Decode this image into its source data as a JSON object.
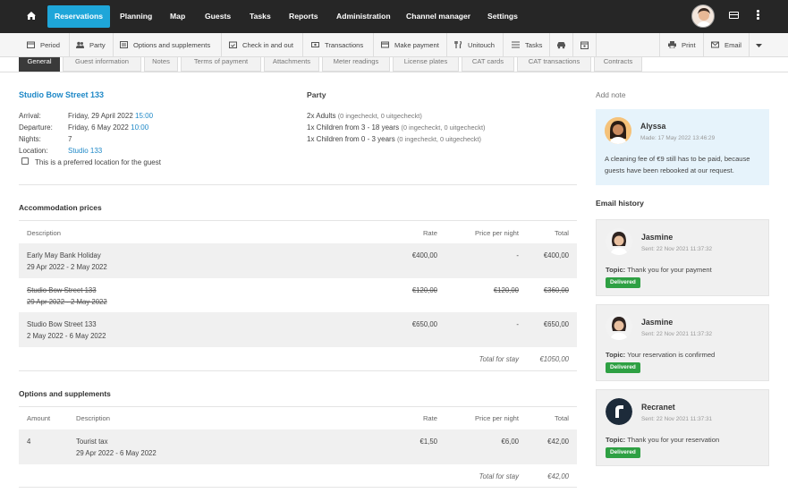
{
  "topnav": {
    "items": [
      "Reservations",
      "Planning",
      "Map",
      "Guests",
      "Tasks",
      "Reports",
      "Administration",
      "Channel manager",
      "Settings"
    ],
    "active": "Reservations",
    "accent_color": "#1ea6d9"
  },
  "subnav": {
    "items": [
      {
        "label": "Period",
        "icon": "calendar-icon"
      },
      {
        "label": "Party",
        "icon": "users-icon"
      },
      {
        "label": "Options and supplements",
        "icon": "options-icon"
      },
      {
        "label": "Check in and out",
        "icon": "calendar-check-icon"
      },
      {
        "label": "Transactions",
        "icon": "money-icon"
      },
      {
        "label": "Make payment",
        "icon": "credit-card-icon"
      },
      {
        "label": "Unitouch",
        "icon": "cutlery-icon"
      },
      {
        "label": "Tasks",
        "icon": "list-icon"
      }
    ],
    "print_label": "Print",
    "email_label": "Email"
  },
  "tabs": [
    "General",
    "Guest information",
    "Notes",
    "Terms of payment",
    "Attachments",
    "Meter readings",
    "License plates",
    "CAT cards",
    "CAT transactions",
    "Contracts"
  ],
  "reservation": {
    "location_title": "Studio Bow Street 133",
    "arrival_label": "Arrival:",
    "arrival_date": "Friday, 29 April 2022",
    "arrival_time": "15:00",
    "departure_label": "Departure:",
    "departure_date": "Friday, 6 May 2022",
    "departure_time": "10:00",
    "nights_label": "Nights:",
    "nights": "7",
    "location_label": "Location:",
    "location": "Studio 133",
    "preferred_label": "This is a preferred location for the guest"
  },
  "party": {
    "title": "Party",
    "lines": [
      {
        "main": "2x Adults",
        "detail": "(0 ingecheckt, 0 uitgecheckt)"
      },
      {
        "main": "1x Children from 3 - 18 years",
        "detail": "(0 ingecheckt, 0 uitgecheckt)"
      },
      {
        "main": "1x Children from 0 - 3 years",
        "detail": "(0 ingecheckt, 0 uitgecheckt)"
      }
    ]
  },
  "accommodation": {
    "title": "Accommodation prices",
    "headers": {
      "description": "Description",
      "rate": "Rate",
      "ppn": "Price per night",
      "total": "Total"
    },
    "rows": [
      {
        "name": "Early May Bank Holiday",
        "dates": "29 Apr 2022 - 2 May 2022",
        "rate": "€400,00",
        "ppn": "-",
        "total": "€400,00",
        "struck": false
      },
      {
        "name": "Studio Bow Street 133",
        "dates": "29 Apr 2022 - 2 May 2022",
        "rate": "€120,00",
        "ppn": "€120,00",
        "total": "€360,00",
        "struck": true
      },
      {
        "name": "Studio Bow Street 133",
        "dates": "2 May 2022 - 6 May 2022",
        "rate": "€650,00",
        "ppn": "-",
        "total": "€650,00",
        "struck": false
      }
    ],
    "total_label": "Total for stay",
    "total": "€1050,00"
  },
  "options": {
    "title": "Options and supplements",
    "headers": {
      "amount": "Amount",
      "description": "Description",
      "rate": "Rate",
      "ppn": "Price per night",
      "total": "Total"
    },
    "rows": [
      {
        "amount": "4",
        "name": "Tourist tax",
        "dates": "29 Apr 2022 - 6 May 2022",
        "rate": "€1,50",
        "ppn": "€6,00",
        "total": "€42,00"
      }
    ],
    "total_label": "Total for stay",
    "total": "€42,00"
  },
  "note": {
    "add_label": "Add note",
    "author": "Alyssa",
    "meta": "Made: 17 May 2022 13:46:29",
    "text": "A cleaning fee of €9 still has to be paid, because guests have been rebooked at our request."
  },
  "email_history": {
    "title": "Email history",
    "topic_label": "Topic:",
    "items": [
      {
        "sender": "Jasmine",
        "sent": "Sent: 22 Nov 2021 11:37:32",
        "topic": "Thank you for your payment",
        "status": "Delivered"
      },
      {
        "sender": "Jasmine",
        "sent": "Sent: 22 Nov 2021 11:37:32",
        "topic": "Your reservation is confirmed",
        "status": "Delivered"
      },
      {
        "sender": "Recranet",
        "sent": "Sent: 22 Nov 2021 11:37:31",
        "topic": "Thank you for your reservation",
        "status": "Delivered"
      }
    ],
    "status_color": "#2ea043"
  }
}
